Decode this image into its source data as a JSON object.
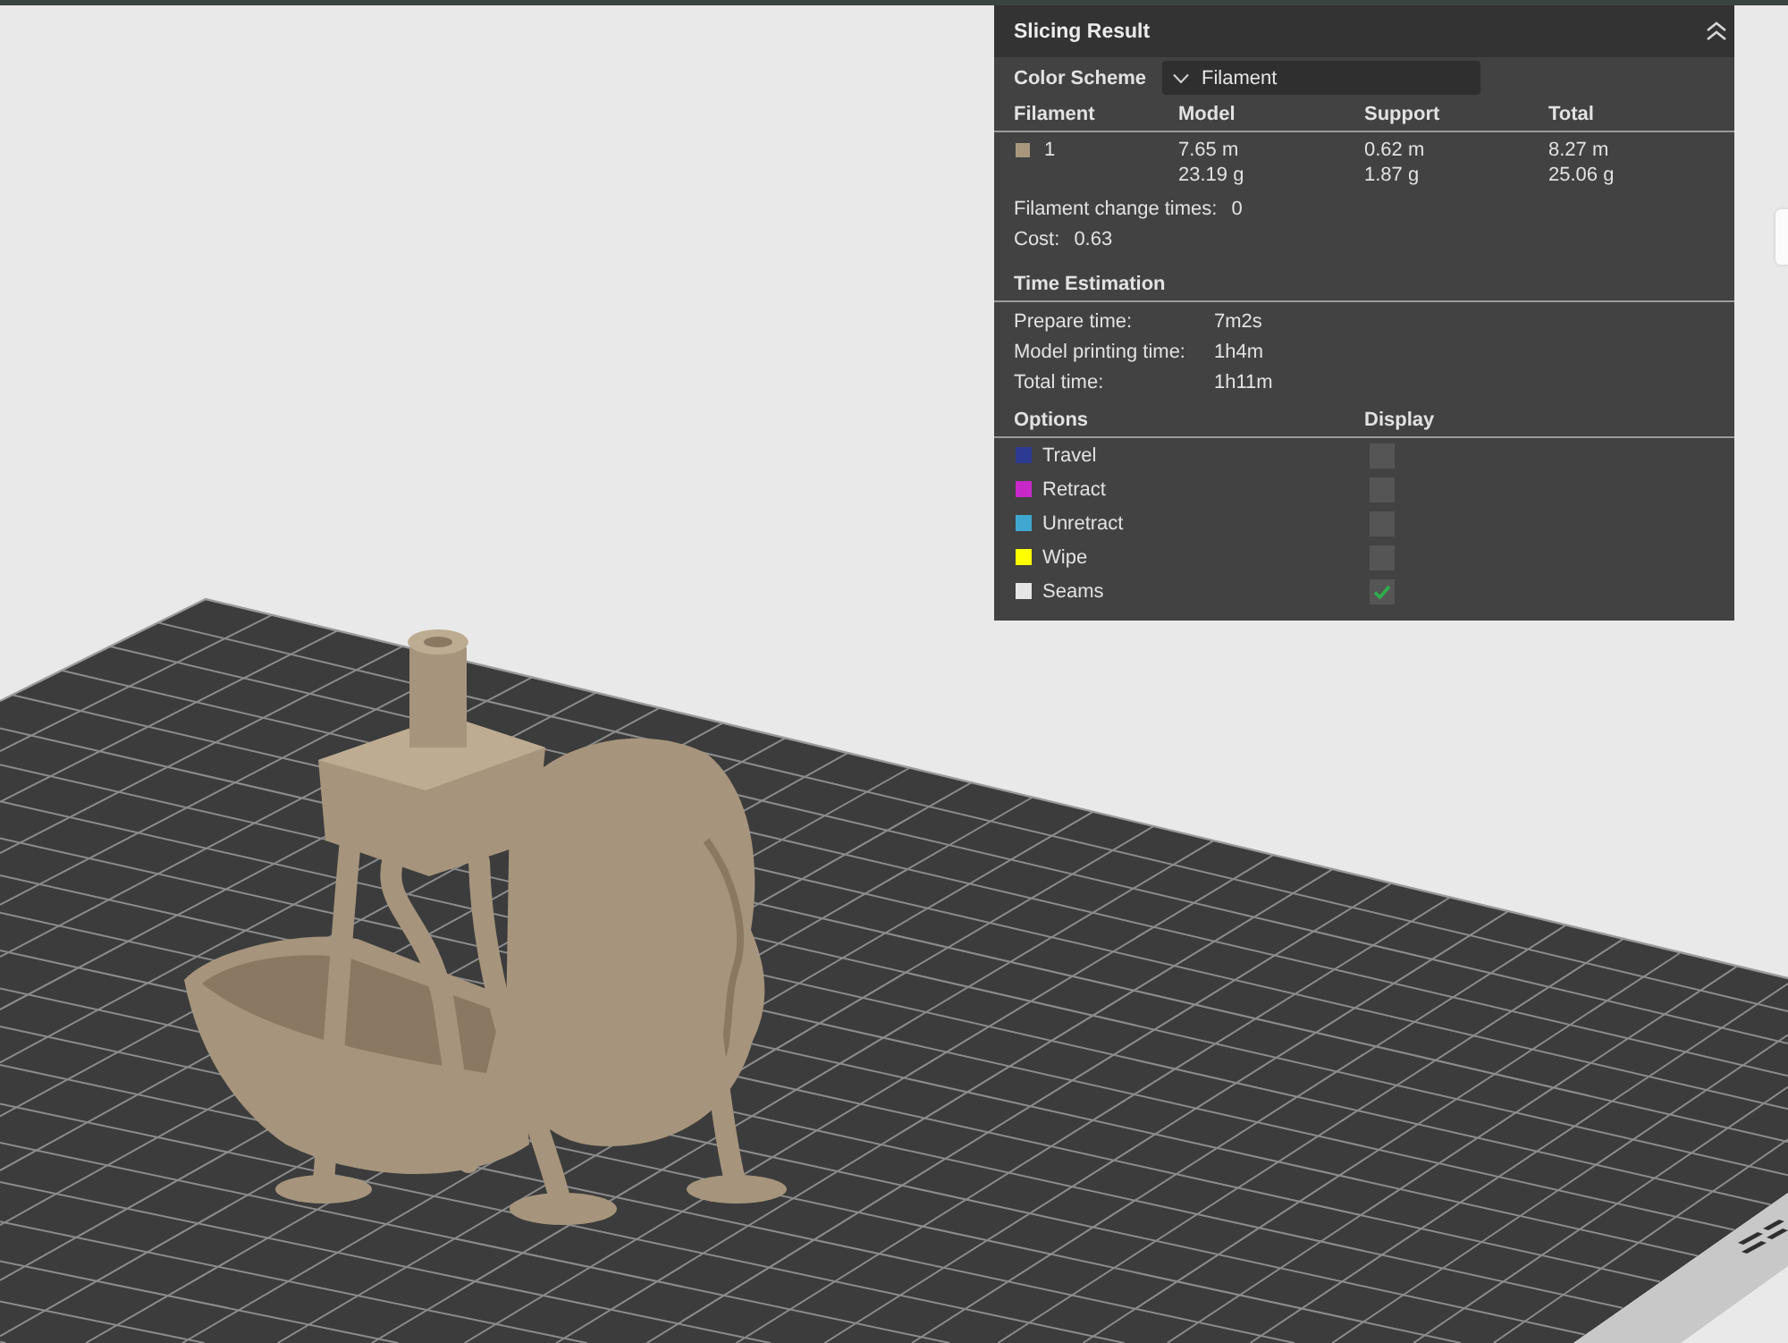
{
  "slicing_result": {
    "title": "Slicing Result",
    "expanded": true,
    "color_scheme": {
      "label": "Color Scheme",
      "value": "Filament"
    },
    "filament_table": {
      "columns": [
        "Filament",
        "Model",
        "Support",
        "Total"
      ],
      "rows": [
        {
          "color": "#a8977d",
          "filament": "1",
          "model": [
            "7.65 m",
            "23.19 g"
          ],
          "support": [
            "0.62 m",
            "1.87 g"
          ],
          "total": [
            "8.27 m",
            "25.06 g"
          ]
        }
      ]
    },
    "summary": [
      {
        "label": "Filament change times:",
        "value": "0"
      },
      {
        "label": "Cost:",
        "value": "0.63"
      }
    ],
    "time_estimation": {
      "title": "Time Estimation",
      "rows": [
        {
          "label": "Prepare time:",
          "value": "7m2s"
        },
        {
          "label": "Model printing time:",
          "value": "1h4m"
        },
        {
          "label": "Total time:",
          "value": "1h11m"
        }
      ]
    },
    "options": {
      "columns": [
        "Options",
        "Display"
      ],
      "items": [
        {
          "label": "Travel",
          "color": "#2d3a92",
          "checked": false
        },
        {
          "label": "Retract",
          "color": "#c828c8",
          "checked": false
        },
        {
          "label": "Unretract",
          "color": "#40a8d0",
          "checked": false
        },
        {
          "label": "Wipe",
          "color": "#ffff00",
          "checked": false
        },
        {
          "label": "Seams",
          "color": "#e6e6e6",
          "checked": true
        }
      ]
    }
  }
}
